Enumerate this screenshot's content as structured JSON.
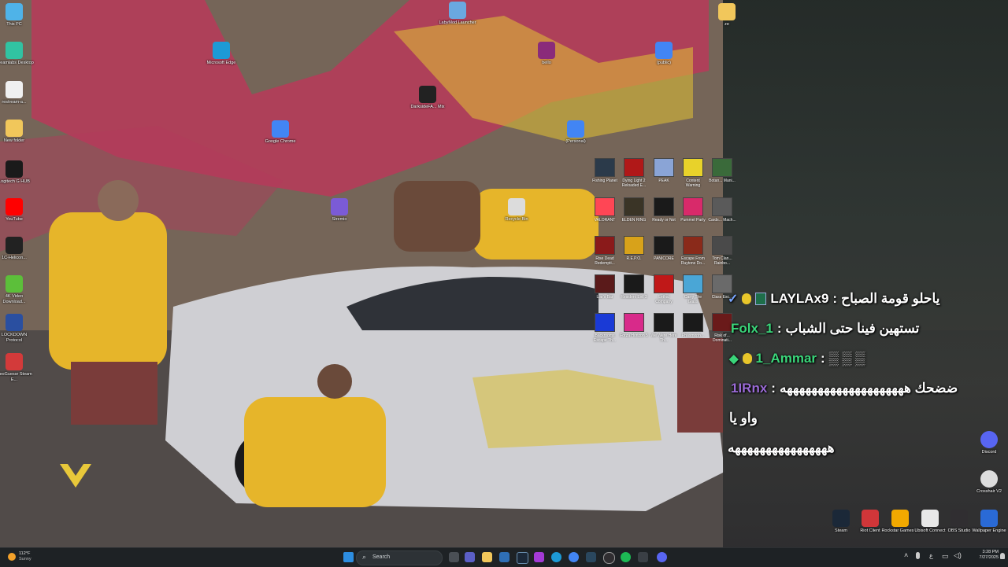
{
  "desktop": {
    "left_icons": [
      {
        "label": "This PC",
        "icon": "monitor-icon",
        "color": "#4fb3e8"
      },
      {
        "label": "Streamlabs Desktop",
        "icon": "streamlabs-icon",
        "color": "#31c3a2"
      },
      {
        "label": "restream-a...",
        "icon": "file-icon",
        "color": "#f0f0f0"
      },
      {
        "label": "New folder",
        "icon": "folder-icon",
        "color": "#f1c75b"
      },
      {
        "label": "Logitech G HUB",
        "icon": "logitech-icon",
        "color": "#1a1a1a"
      },
      {
        "label": "YouTube",
        "icon": "youtube-icon",
        "color": "#ff0000"
      },
      {
        "label": "1C-Helicon...",
        "icon": "x-icon",
        "color": "#222222"
      },
      {
        "label": "4K Video Download...",
        "icon": "android-icon",
        "color": "#5cbf3a"
      },
      {
        "label": "LOCKDOWN Protocol",
        "icon": "lockdown-icon",
        "color": "#2a4fa0"
      },
      {
        "label": "GeoGuessr Steam E...",
        "icon": "map-pin-icon",
        "color": "#d33a3a"
      }
    ],
    "free_icons": [
      {
        "label": "LabyMod Launcher",
        "icon": "fox-icon",
        "color": "#6aa8e0"
      },
      {
        "label": "Microsoft Edge",
        "icon": "edge-icon",
        "color": "#1d9ad6"
      },
      {
        "label": "DarksideFA... Mix",
        "icon": "video-file-icon",
        "color": "#222222"
      },
      {
        "label": "bello",
        "icon": "winrar-icon",
        "color": "#8a2b7a"
      },
      {
        "label": "(public)",
        "icon": "chrome-icon",
        "color": "#4285f4"
      },
      {
        "label": "Google Chrome",
        "icon": "chrome-icon",
        "color": "#4285f4"
      },
      {
        "label": "(Personal)",
        "icon": "chrome-icon",
        "color": "#4285f4"
      },
      {
        "label": "Stremio",
        "icon": "stremio-icon",
        "color": "#7b5bd6"
      },
      {
        "label": "Recycle Bin",
        "icon": "recycle-bin-icon",
        "color": "#dcdcdc"
      },
      {
        "label": "ze",
        "icon": "file-icon",
        "color": "#f1c75b"
      }
    ],
    "game_icons": [
      {
        "label": "Fishing Planet",
        "color": "#2b3a4a"
      },
      {
        "label": "Dying Light 2 Reloaded E...",
        "color": "#b01818"
      },
      {
        "label": "PEAK",
        "color": "#8aa4d6"
      },
      {
        "label": "Content Warning",
        "color": "#e8d22a"
      },
      {
        "label": "Botan... Mani...",
        "color": "#3a6a3a"
      },
      {
        "label": "VALORANT",
        "color": "#ff4655"
      },
      {
        "label": "ELDEN RING",
        "color": "#3a3426"
      },
      {
        "label": "Ready or Not",
        "color": "#1a1a1a"
      },
      {
        "label": "Pummel Party",
        "color": "#d82a6a"
      },
      {
        "label": "Cards... Mach...",
        "color": "#5a5a5a"
      },
      {
        "label": "Rise Dead Redempti...",
        "color": "#8a1a1a"
      },
      {
        "label": "R.E.P.O.",
        "color": "#d8a21a"
      },
      {
        "label": "PANICORE",
        "color": "#1a1a1a"
      },
      {
        "label": "Escape From Ruytons Do...",
        "color": "#8a2a1a"
      },
      {
        "label": "Tom Clan... Rainbo...",
        "color": "#4a4a4a"
      },
      {
        "label": "Liar's Bar",
        "color": "#5a1a1a"
      },
      {
        "label": "Resident Evil 3",
        "color": "#1a1a1a"
      },
      {
        "label": "Lethal Company",
        "color": "#c01818"
      },
      {
        "label": "Carry The Glass",
        "color": "#4aa6d6"
      },
      {
        "label": "Class Esc...",
        "color": "#6a6a6a"
      },
      {
        "label": "Backrooms Escape Th...",
        "color": "#1a3ad6"
      },
      {
        "label": "Forza Horizon 5",
        "color": "#d82a8a"
      },
      {
        "label": "We Were Here Th...",
        "color": "#1a1a1a"
      },
      {
        "label": "Phasmoph...",
        "color": "#1a1a1a"
      },
      {
        "label": "Risk of... Dominati...",
        "color": "#6a1a1a"
      }
    ],
    "right_icons": [
      {
        "label": "Discord",
        "icon": "discord-icon",
        "color": "#5865f2"
      },
      {
        "label": "Crosshair V2",
        "icon": "crosshair-icon",
        "color": "#dddddd"
      }
    ],
    "bottom_icons": [
      {
        "label": "Steam",
        "icon": "steam-icon",
        "color": "#1b2838"
      },
      {
        "label": "Riot Client",
        "icon": "riot-icon",
        "color": "#d13639"
      },
      {
        "label": "Rockstar Games ...",
        "icon": "rockstar-icon",
        "color": "#f2a900"
      },
      {
        "label": "Ubisoft Connect",
        "icon": "ubisoft-icon",
        "color": "#e8e8e8"
      },
      {
        "label": "OBS Studio",
        "icon": "obs-icon",
        "color": "#302e31"
      },
      {
        "label": "Wallpaper Engine",
        "icon": "wallpaper-engine-icon",
        "color": "#2a6ad6"
      }
    ]
  },
  "chat": {
    "messages": [
      {
        "user": "LAYLAx9",
        "user_color": "#ffffff",
        "sep": " : ",
        "text": "ياحلو قومة الصباح",
        "badges": [
          "check-badge-icon",
          "badge-icon",
          "qr-badge-icon"
        ]
      },
      {
        "user": "Folx_1",
        "user_color": "#3ad67a",
        "sep": " : ",
        "text": "تستهين فينا حتى الشباب",
        "badges": []
      },
      {
        "user": "1_Ammar",
        "user_color": "#3ad67a",
        "sep": " : ",
        "text": "▒ ▒ ▒",
        "badges": [
          "diamond-badge-icon",
          "badge-icon"
        ]
      },
      {
        "user": "1IRnx",
        "user_color": "#9a6ad6",
        "sep": " : ",
        "text": "ضضحك ههههههههههههههههههههه",
        "badges": []
      },
      {
        "user": "",
        "user_color": "#ffffff",
        "sep": "",
        "text": "واو يا",
        "badges": []
      },
      {
        "user": "",
        "user_color": "#ffffff",
        "sep": "",
        "text": "ههههههههههههههههه",
        "badges": []
      }
    ]
  },
  "taskbar": {
    "weather_temp": "112°F",
    "weather_desc": "Sunny",
    "search_placeholder": "Search",
    "time": "3:28 PM",
    "date": "7/27/2025",
    "lang": "ع",
    "accent": "#0078d4"
  }
}
